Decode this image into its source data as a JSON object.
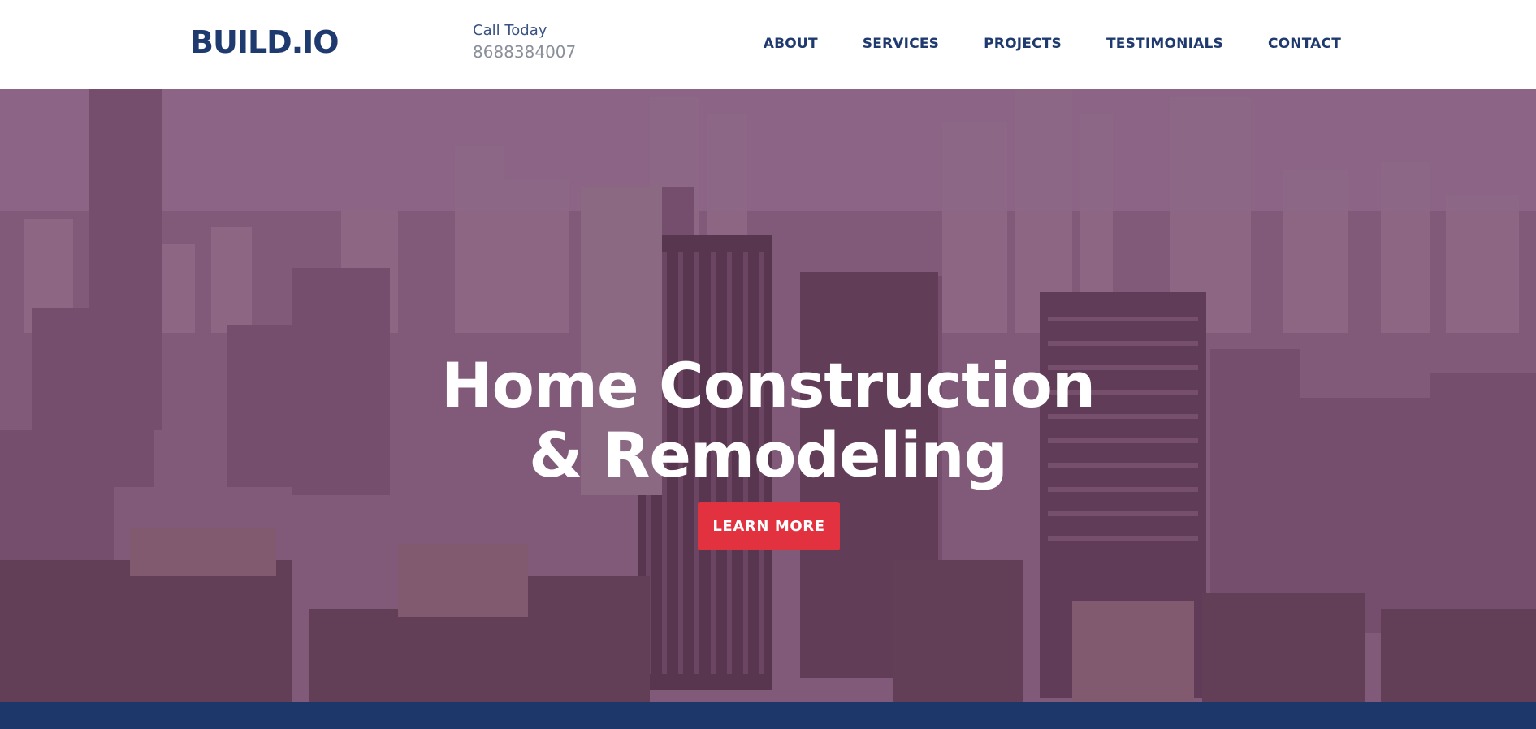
{
  "header": {
    "logo": "BUILD.IO",
    "call_label": "Call Today",
    "call_number": "8688384007"
  },
  "nav": {
    "items": [
      {
        "label": "ABOUT"
      },
      {
        "label": "SERVICES"
      },
      {
        "label": "PROJECTS"
      },
      {
        "label": "TESTIMONIALS"
      },
      {
        "label": "CONTACT"
      }
    ]
  },
  "hero": {
    "title_line1": "Home Construction",
    "title_line2": "& Remodeling",
    "cta_label": "LEARN MORE",
    "background_image": "aerial city skyline with purple tint"
  },
  "colors": {
    "brand_navy": "#1f3a6e",
    "cta_red": "#e2323f",
    "bottom_bar": "#1e376b"
  }
}
